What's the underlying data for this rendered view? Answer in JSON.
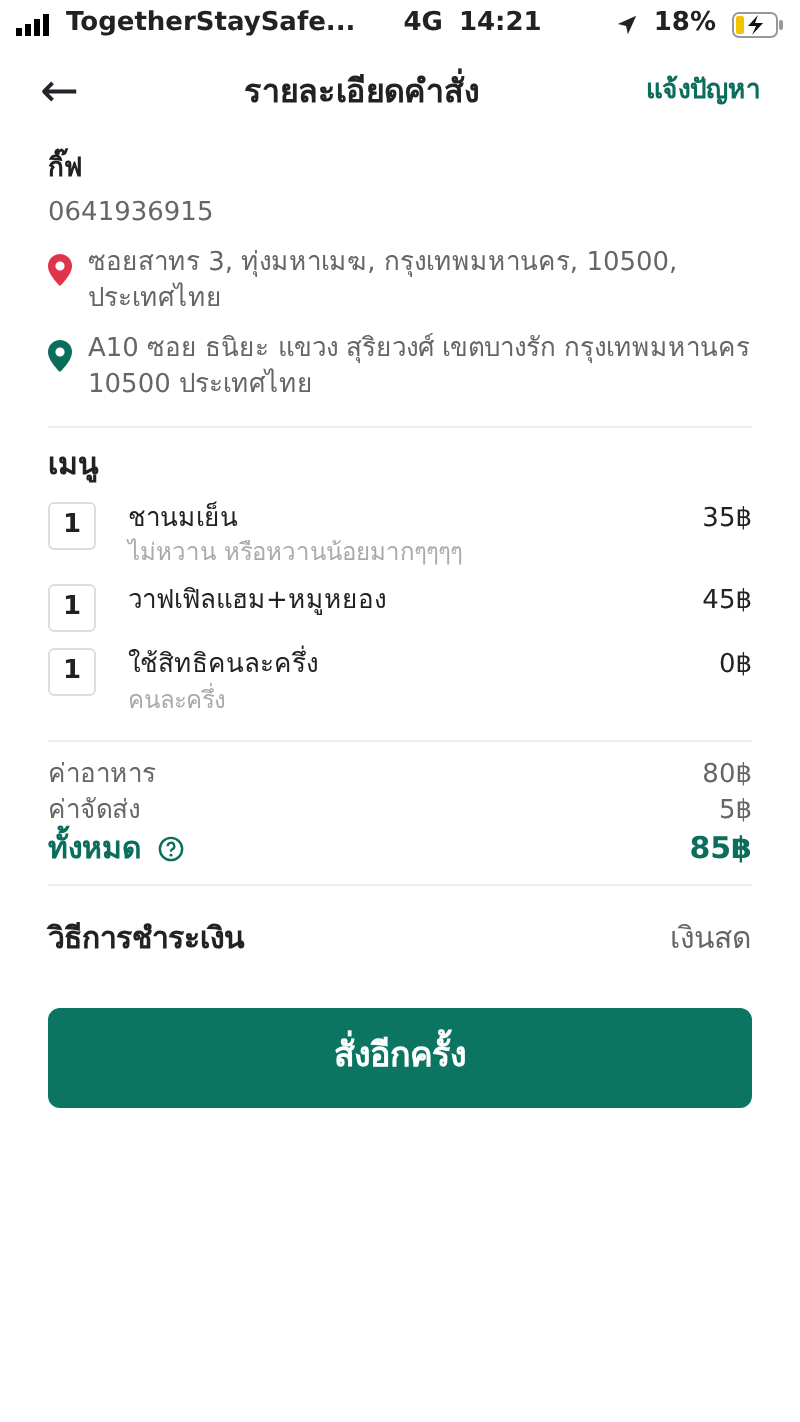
{
  "status_bar": {
    "carrier": "TogetherStaySafe...",
    "network": "4G",
    "time": "14:21",
    "battery": "18%"
  },
  "header": {
    "back": "←",
    "title": "รายละเอียดคำสั่ง",
    "action": "แจ้งปัญหา"
  },
  "customer": {
    "name": "กิ๊ฟ",
    "phone": "0641936915"
  },
  "addresses": [
    {
      "text": "ซอยสาทร 3, ทุ่งมหาเมฆ, กรุงเทพมหานคร, 10500, ประเทศไทย",
      "color": "#e0344a"
    },
    {
      "text": "A10 ซอย ธนิยะ แขวง สุริยวงศ์ เขตบางรัก กรุงเทพมหานคร 10500 ประเทศไทย",
      "color": "#0b6e5c"
    }
  ],
  "menu": {
    "heading": "เมนู",
    "items": [
      {
        "qty": "1",
        "name": "ชานมเย็น",
        "note": "ไม่หวาน หรือหวานน้อยมากๆๆๆๆ",
        "price": "35฿"
      },
      {
        "qty": "1",
        "name": "วาฟเฟิลแฮม+หมูหยอง",
        "price": "45฿"
      },
      {
        "qty": "1",
        "name": "ใช้สิทธิคนละครึ่ง",
        "note": "คนละครึ่ง",
        "price": "0฿"
      }
    ]
  },
  "summary": [
    {
      "label": "ค่าอาหาร",
      "value": "80฿",
      "kind": "line"
    },
    {
      "label": "ค่าจัดส่ง",
      "value": "5฿",
      "kind": "line"
    },
    {
      "label": "ทั้งหมด",
      "value": "85฿",
      "kind": "total"
    }
  ],
  "payment": {
    "label": "วิธีการชำระเงิน",
    "value": "เงินสด"
  },
  "button": "สั่งอีกครั้ง"
}
